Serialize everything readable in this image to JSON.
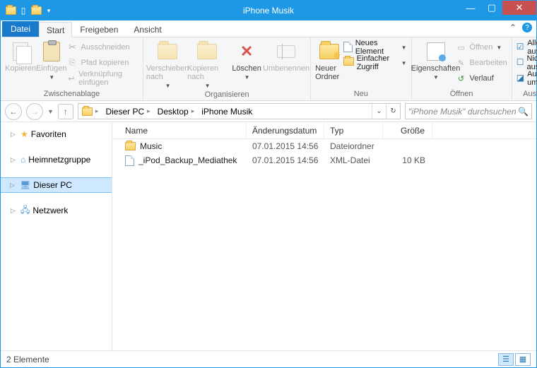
{
  "window": {
    "title": "iPhone Musik"
  },
  "tabs": {
    "file": "Datei",
    "start": "Start",
    "share": "Freigeben",
    "view": "Ansicht"
  },
  "ribbon": {
    "clipboard": {
      "copy": "Kopieren",
      "paste": "Einfügen",
      "cut": "Ausschneiden",
      "copypath": "Pfad kopieren",
      "pastelnk": "Verknüpfung einfügen",
      "label": "Zwischenablage"
    },
    "organize": {
      "moveto": "Verschieben nach",
      "copyto": "Kopieren nach",
      "delete": "Löschen",
      "rename": "Umbenennen",
      "label": "Organisieren"
    },
    "new": {
      "newfolder": "Neuer Ordner",
      "newitem": "Neues Element",
      "easyaccess": "Einfacher Zugriff",
      "label": "Neu"
    },
    "open": {
      "properties": "Eigenschaften",
      "open": "Öffnen",
      "edit": "Bearbeiten",
      "history": "Verlauf",
      "label": "Öffnen"
    },
    "select": {
      "all": "Alles auswählen",
      "none": "Nichts auswählen",
      "invert": "Auswahl umkehren",
      "label": "Auswählen"
    }
  },
  "breadcrumb": {
    "root": "Dieser PC",
    "p1": "Desktop",
    "p2": "iPhone Musik"
  },
  "search": {
    "placeholder": "\"iPhone Musik\" durchsuchen"
  },
  "navpane": {
    "favorites": "Favoriten",
    "homegroup": "Heimnetzgruppe",
    "thispc": "Dieser PC",
    "network": "Netzwerk"
  },
  "columns": {
    "name": "Name",
    "date": "Änderungsdatum",
    "type": "Typ",
    "size": "Größe"
  },
  "files": [
    {
      "icon": "folder",
      "name": "Music",
      "date": "07.01.2015 14:56",
      "type": "Dateiordner",
      "size": ""
    },
    {
      "icon": "file",
      "name": "_iPod_Backup_Mediathek",
      "date": "07.01.2015 14:56",
      "type": "XML-Datei",
      "size": "10 KB"
    }
  ],
  "status": {
    "text": "2 Elemente"
  }
}
